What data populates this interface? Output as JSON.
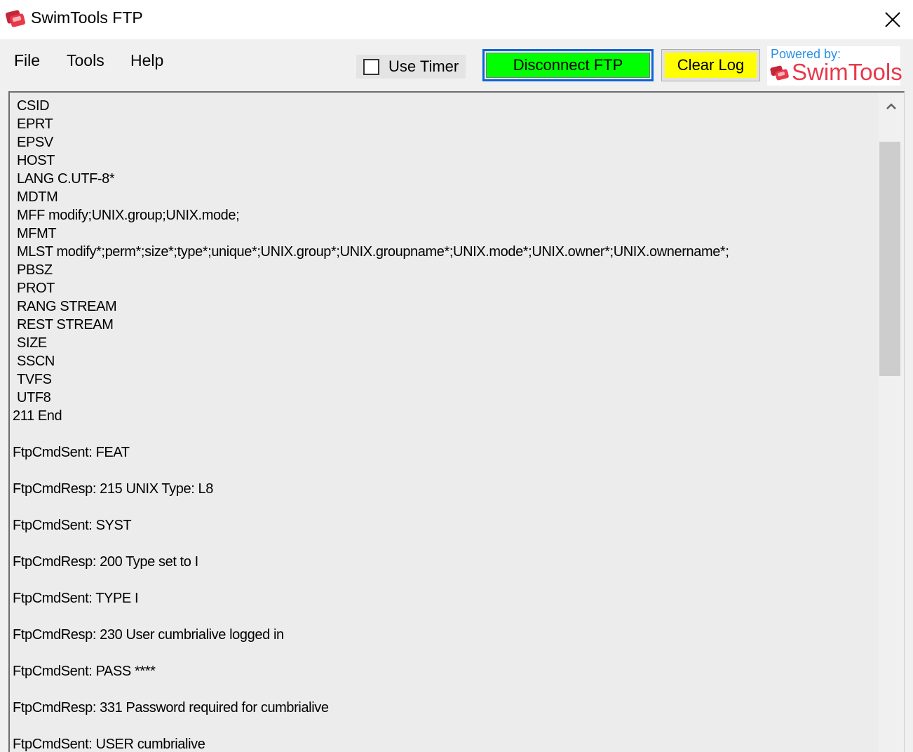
{
  "window": {
    "title": "SwimTools FTP",
    "icon": "app-icon",
    "close_icon": "close-icon"
  },
  "menu": {
    "items": [
      {
        "label": "File"
      },
      {
        "label": "Tools"
      },
      {
        "label": "Help"
      }
    ]
  },
  "toolbar": {
    "use_timer_label": "Use Timer",
    "use_timer_checked": false,
    "disconnect_label": "Disconnect FTP",
    "clear_log_label": "Clear Log"
  },
  "logo": {
    "powered_text": "Powered by:",
    "brand_text": "SwimTools"
  },
  "colors": {
    "disconnect_bg": "#00ff00",
    "disconnect_focus_border": "#0a64d6",
    "clear_bg": "#ffff00",
    "logo_red": "#e8394a",
    "logo_blue": "#2a8fe6"
  },
  "log": {
    "lines": [
      {
        "text": "CSID",
        "indent": true
      },
      {
        "text": "EPRT",
        "indent": true
      },
      {
        "text": "EPSV",
        "indent": true
      },
      {
        "text": "HOST",
        "indent": true
      },
      {
        "text": "LANG C.UTF-8*",
        "indent": true
      },
      {
        "text": "MDTM",
        "indent": true
      },
      {
        "text": "MFF modify;UNIX.group;UNIX.mode;",
        "indent": true
      },
      {
        "text": "MFMT",
        "indent": true
      },
      {
        "text": "MLST modify*;perm*;size*;type*;unique*;UNIX.group*;UNIX.groupname*;UNIX.mode*;UNIX.owner*;UNIX.ownername*;",
        "indent": true
      },
      {
        "text": "PBSZ",
        "indent": true
      },
      {
        "text": "PROT",
        "indent": true
      },
      {
        "text": "RANG STREAM",
        "indent": true
      },
      {
        "text": "REST STREAM",
        "indent": true
      },
      {
        "text": "SIZE",
        "indent": true
      },
      {
        "text": "SSCN",
        "indent": true
      },
      {
        "text": "TVFS",
        "indent": true
      },
      {
        "text": "UTF8",
        "indent": true
      },
      {
        "text": "211 End",
        "indent": false
      },
      {
        "text": "",
        "indent": false
      },
      {
        "text": "FtpCmdSent: FEAT",
        "indent": false
      },
      {
        "text": "",
        "indent": false
      },
      {
        "text": "FtpCmdResp: 215 UNIX Type: L8",
        "indent": false
      },
      {
        "text": "",
        "indent": false
      },
      {
        "text": "FtpCmdSent: SYST",
        "indent": false
      },
      {
        "text": "",
        "indent": false
      },
      {
        "text": "FtpCmdResp: 200 Type set to I",
        "indent": false
      },
      {
        "text": "",
        "indent": false
      },
      {
        "text": "FtpCmdSent: TYPE I",
        "indent": false
      },
      {
        "text": "",
        "indent": false
      },
      {
        "text": "FtpCmdResp: 230 User cumbrialive logged in",
        "indent": false
      },
      {
        "text": "",
        "indent": false
      },
      {
        "text": "FtpCmdSent: PASS ****",
        "indent": false
      },
      {
        "text": "",
        "indent": false
      },
      {
        "text": "FtpCmdResp: 331 Password required for cumbrialive",
        "indent": false
      },
      {
        "text": "",
        "indent": false
      },
      {
        "text": "FtpCmdSent: USER cumbrialive",
        "indent": false
      }
    ]
  }
}
